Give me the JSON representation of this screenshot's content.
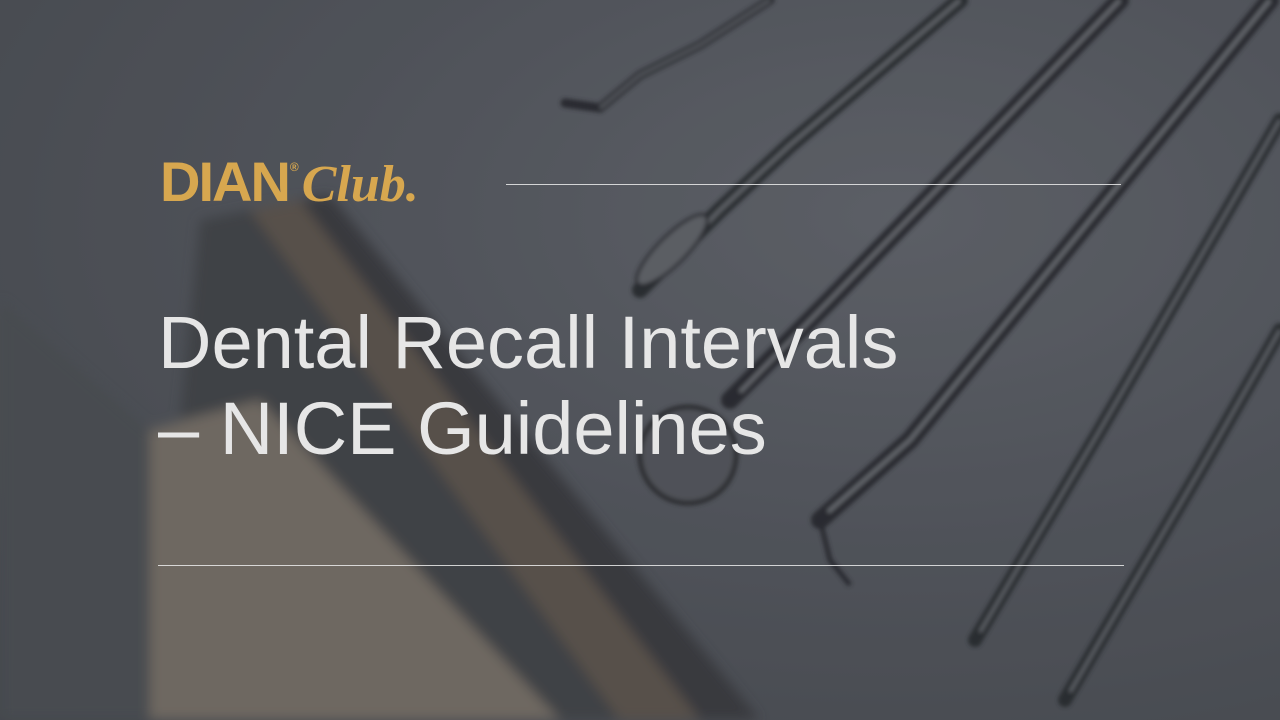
{
  "logo": {
    "brand": "DIAN",
    "registered_mark": "®",
    "sub_brand": "Club."
  },
  "title": {
    "line1": "Dental Recall Intervals",
    "line2": "– NICE Guidelines"
  },
  "colors": {
    "logo_gold": "#d7a74f",
    "title_text": "#e6e6e6",
    "rule": "#ebebeb",
    "background": "#5f626a"
  }
}
